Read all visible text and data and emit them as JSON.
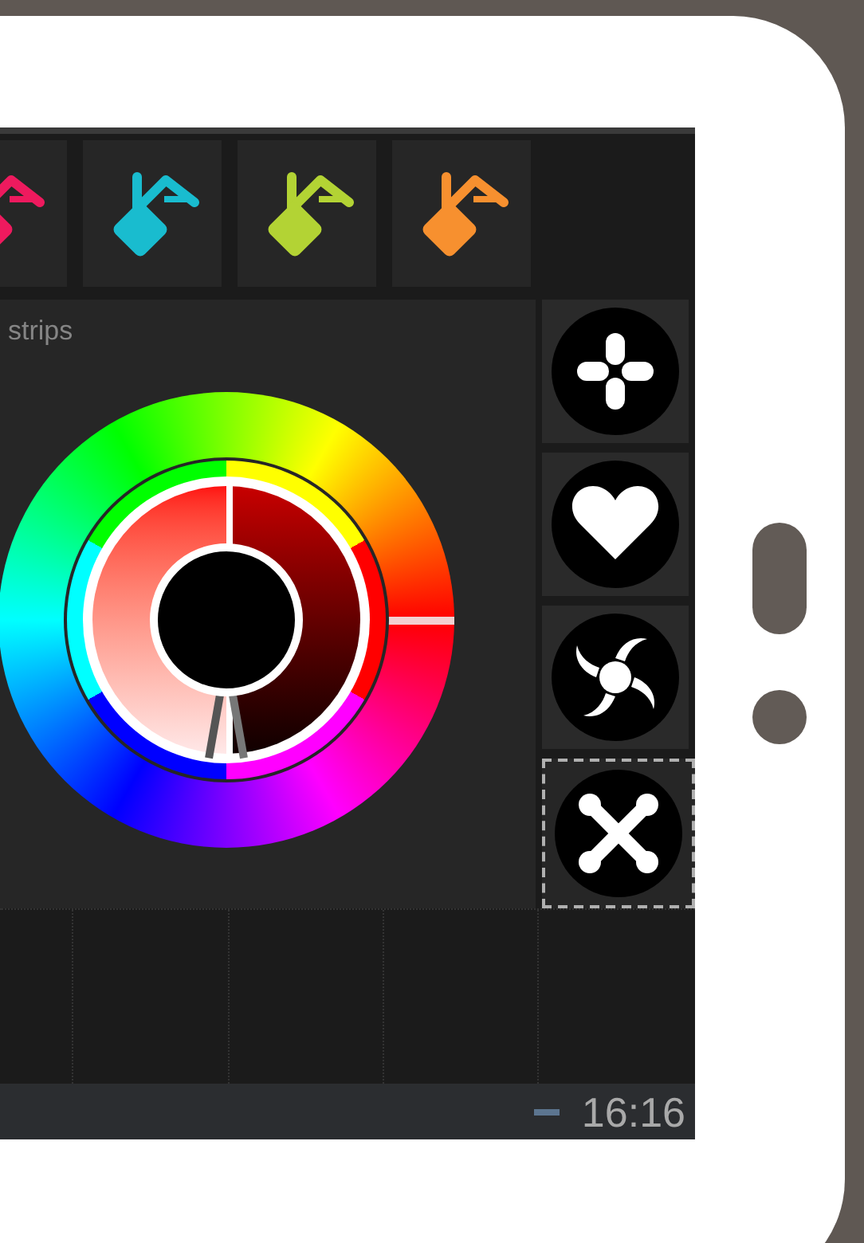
{
  "color_tiles": [
    {
      "color": "#ee1a5e",
      "selected": false
    },
    {
      "color": "#19bccf",
      "selected": false
    },
    {
      "color": "#b3d334",
      "selected": false
    },
    {
      "color": "#f7902f",
      "selected": false
    }
  ],
  "panel": {
    "title": "strips"
  },
  "mode_buttons": [
    {
      "kind": "cross",
      "selected": false
    },
    {
      "kind": "heart",
      "selected": false
    },
    {
      "kind": "swirl",
      "selected": false
    },
    {
      "kind": "x",
      "selected": true
    }
  ],
  "status_bar": {
    "clock": "16:16"
  }
}
